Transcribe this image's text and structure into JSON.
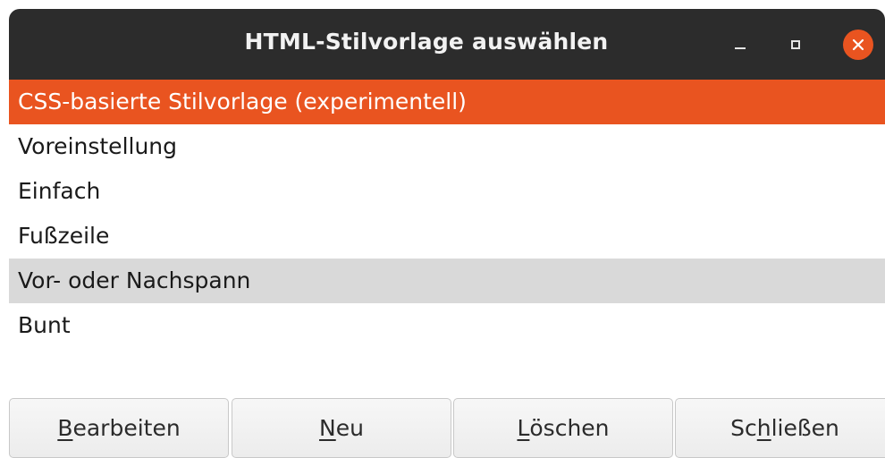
{
  "window": {
    "title": "HTML-Stilvorlage auswählen"
  },
  "list": {
    "items": [
      {
        "label": "CSS-basierte Stilvorlage (experimentell)",
        "state": "selected"
      },
      {
        "label": "Voreinstellung",
        "state": "normal"
      },
      {
        "label": "Einfach",
        "state": "normal"
      },
      {
        "label": "Fußzeile",
        "state": "normal"
      },
      {
        "label": "Vor- oder Nachspann",
        "state": "hover"
      },
      {
        "label": "Bunt",
        "state": "normal"
      }
    ]
  },
  "buttons": {
    "edit": {
      "mnemonic": "B",
      "rest": "earbeiten"
    },
    "new": {
      "mnemonic": "N",
      "rest": "eu"
    },
    "delete": {
      "mnemonic": "L",
      "rest": "öschen"
    },
    "close": {
      "before": "Sc",
      "mnemonic": "h",
      "rest": "ließen"
    }
  },
  "colors": {
    "accent": "#e95420",
    "titlebar": "#2c2c2c",
    "hover_row": "#d9d9d9"
  },
  "icons": {
    "minimize": "minimize-icon",
    "maximize": "maximize-icon",
    "close": "close-icon"
  }
}
